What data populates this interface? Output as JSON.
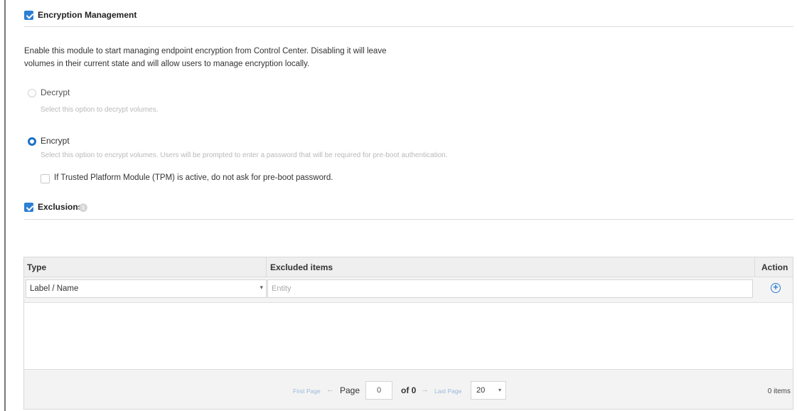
{
  "encryption": {
    "title": "Encryption Management",
    "enabled": true,
    "description_line1": "Enable this module to start managing endpoint encryption from Control Center. Disabling it will leave",
    "description_line2": "volumes in their current state and will allow users to manage encryption locally.",
    "options": [
      {
        "label": "Decrypt",
        "hint": "Select this option to decrypt volumes.",
        "selected": false
      },
      {
        "label": "Encrypt",
        "hint": "Select this option to encrypt volumes. Users will be prompted to enter a password that will be required for pre-boot authentication.",
        "selected": true
      }
    ],
    "tpm_option": {
      "label": "If Trusted Platform Module (TPM) is active, do not ask for pre-boot password.",
      "checked": false
    }
  },
  "exclusions": {
    "title": "Exclusions",
    "enabled": true,
    "info_icon": "info-icon",
    "table": {
      "columns": [
        "Type",
        "Excluded items",
        "Action"
      ],
      "filter": {
        "type_value": "Label / Name",
        "entity_placeholder": "Entity",
        "add_icon": "add-circle-icon"
      },
      "rows": [],
      "pagination": {
        "first_page": "First Page",
        "prev_arrow": "←",
        "page_label": "Page",
        "page_value": "0",
        "of_label": "of 0",
        "next_arrow": "→",
        "last_page": "Last Page",
        "per_page": "20",
        "items_count": "0 items"
      }
    }
  },
  "colors": {
    "accent": "#2d7fd3",
    "header_bg": "#efefef",
    "footer_bg": "#f3f3f3"
  }
}
